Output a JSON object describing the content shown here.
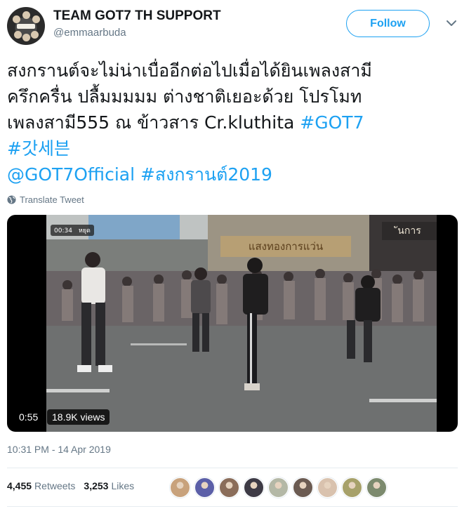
{
  "account": {
    "display_name": "TEAM GOT7 TH SUPPORT",
    "handle": "@emmaarbuda",
    "follow_label": "Follow"
  },
  "tweet": {
    "lines": [
      "สงกรานต์จะไม่น่าเบื่ออีกต่อไปเมื่อได้ยินเพลงสามี",
      "ครึกครื่น ปลื้มมมมม ต่างชาติเยอะด้วย โปรโมท",
      "เพลงสามี555 ณ ข้าวสาร Cr.kluthita"
    ],
    "hashtag_got7": "#GOT7",
    "hashtag_korean": "#갓세븐",
    "mention": "@GOT7Official",
    "hashtag_songkran": "#สงกรานต์2019",
    "translate_label": "Translate Tweet"
  },
  "video": {
    "inner_time": "00:34",
    "inner_pause_label": "หยุด",
    "sign_text": "แสงทองการแว่น",
    "sign2_text": "ันการ",
    "duration": "0:55",
    "views": "18.9K views"
  },
  "meta": {
    "timestamp": "10:31 PM - 14 Apr 2019",
    "retweets_count": "4,455",
    "retweets_label": "Retweets",
    "likes_count": "3,253",
    "likes_label": "Likes"
  },
  "colors": {
    "accent": "#1da1f2",
    "secondary_text": "#657786",
    "primary_text": "#14171a",
    "divider": "#e6ecf0"
  },
  "liker_avatars": [
    "#c8a27c",
    "#5b5fa8",
    "#8a6d5a",
    "#3d3a45",
    "#b4b8a6",
    "#6b5b52",
    "#d9c2ae",
    "#a7a16a",
    "#7c8a6e"
  ]
}
